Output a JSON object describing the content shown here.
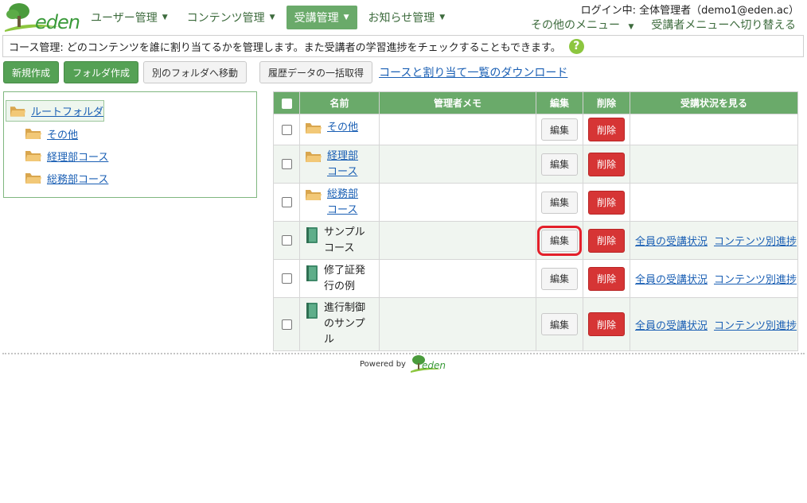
{
  "header": {
    "logo_text": "eden",
    "nav": [
      {
        "label": "ユーザー管理",
        "active": false
      },
      {
        "label": "コンテンツ管理",
        "active": false
      },
      {
        "label": "受講管理",
        "active": true
      },
      {
        "label": "お知らせ管理",
        "active": false
      }
    ],
    "login_info": "ログイン中: 全体管理者（demo1@eden.ac）",
    "other_menu": "その他のメニュー",
    "switch_menu": "受講者メニューへ切り替える"
  },
  "infobar": {
    "text": "コース管理: どのコンテンツを誰に割り当てるかを管理します。また受講者の学習進捗をチェックすることもできます。",
    "help_icon": "?"
  },
  "toolbar": {
    "new_label": "新規作成",
    "folder_label": "フォルダ作成",
    "move_label": "別のフォルダへ移動",
    "history_label": "履歴データの一括取得",
    "download_link": "コースと割り当て一覧のダウンロード"
  },
  "tree": {
    "root": "ルートフォルダ",
    "items": [
      "その他",
      "経理部コース",
      "総務部コース"
    ]
  },
  "table": {
    "headers": [
      "名前",
      "管理者メモ",
      "編集",
      "削除",
      "受講状況を見る"
    ],
    "edit_label": "編集",
    "delete_label": "削除",
    "status_all": "全員の受講状況",
    "status_content": "コンテンツ別進捗",
    "rows": [
      {
        "type": "folder",
        "name_lines": [
          "その他"
        ]
      },
      {
        "type": "folder",
        "name_lines": [
          "経理部",
          "コース"
        ]
      },
      {
        "type": "folder",
        "name_lines": [
          "総務部",
          "コース"
        ]
      },
      {
        "type": "course",
        "name_lines": [
          "サンプル",
          "コース"
        ]
      },
      {
        "type": "course",
        "name_lines": [
          "修了証発",
          "行の例"
        ]
      },
      {
        "type": "course",
        "name_lines": [
          "進行制御",
          "のサンプル"
        ]
      }
    ]
  },
  "footer": {
    "powered_by": "Powered by",
    "logo_text": "eden"
  },
  "colors": {
    "accent_green": "#6aaa6a",
    "button_green": "#55a155",
    "delete_red": "#d63535",
    "link_blue": "#1a5fb4",
    "focus_red": "#e3202a"
  }
}
